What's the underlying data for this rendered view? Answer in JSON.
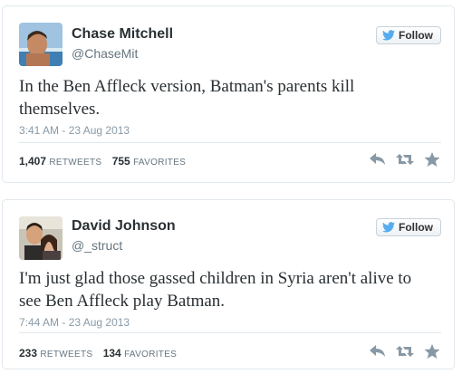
{
  "colors": {
    "name": "#292f33",
    "secondary": "#66757f",
    "timestamp": "#8899a6",
    "twitter_blue": "#55acee",
    "icon_gray": "#8899a6"
  },
  "tweets": [
    {
      "author_name": "Chase Mitchell",
      "handle": "@ChaseMit",
      "follow_label": "Follow",
      "text": "In the Ben Affleck version, Batman's parents kill themselves.",
      "timestamp": "3:41 AM - 23 Aug 2013",
      "retweets_count": "1,407",
      "retweets_label": "RETWEETS",
      "favorites_count": "755",
      "favorites_label": "FAVORITES"
    },
    {
      "author_name": "David Johnson",
      "handle": "@_struct",
      "follow_label": "Follow",
      "text": "I'm just glad those gassed children in Syria aren't alive to see Ben Affleck play Batman.",
      "timestamp": "7:44 AM - 23 Aug 2013",
      "retweets_count": "233",
      "retweets_label": "RETWEETS",
      "favorites_count": "134",
      "favorites_label": "FAVORITES"
    }
  ],
  "icons": {
    "follow": "twitter-bird-icon",
    "reply": "reply-icon",
    "retweet": "retweet-icon",
    "favorite": "star-icon"
  }
}
